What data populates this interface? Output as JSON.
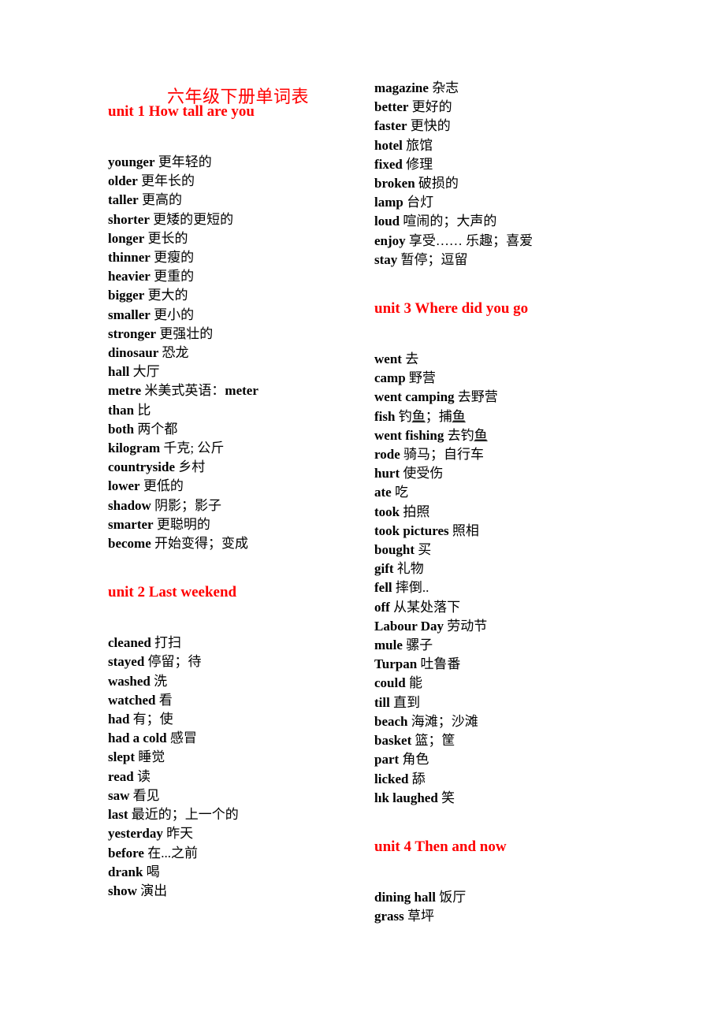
{
  "document": {
    "title": "六年级下册单词表",
    "title_color": "#ff0000",
    "heading_color": "#ff0000",
    "body_color": "#000000",
    "background": "#ffffff"
  },
  "columns": {
    "left": {
      "blocks": [
        {
          "type": "heading",
          "text": "unit 1 How tall are you"
        },
        {
          "type": "list",
          "entries": [
            {
              "en": "younger",
              "cn": "更年轻的"
            },
            {
              "en": "older",
              "cn": "更年长的"
            },
            {
              "en": "taller",
              "cn": "更高的"
            },
            {
              "en": "shorter",
              "cn": "更矮的更短的"
            },
            {
              "en": "longer",
              "cn": "更长的"
            },
            {
              "en": "thinner",
              "cn": "更瘦的"
            },
            {
              "en": "heavier",
              "cn": "更重的"
            },
            {
              "en": "bigger",
              "cn": "更大的"
            },
            {
              "en": "smaller",
              "cn": "更小的"
            },
            {
              "en": "stronger",
              "cn": "更强壮的"
            },
            {
              "en": "dinosaur",
              "cn": "恐龙"
            },
            {
              "en": "hall",
              "cn": "大厅"
            },
            {
              "en": "metre",
              "cn": "米美式英语：",
              "cn_bold_tail": "meter"
            },
            {
              "en": "than",
              "cn": "比"
            },
            {
              "en": "both",
              "cn": "两个都"
            },
            {
              "en": "kilogram",
              "cn": "千克; 公斤"
            },
            {
              "en": "countryside",
              "cn": "乡村"
            },
            {
              "en": "lower",
              "cn": " 更低的"
            },
            {
              "en": "shadow",
              "cn": "阴影；影子"
            },
            {
              "en": "smarter",
              "cn": "更聪明的"
            },
            {
              "en": "become",
              "cn": "开始变得；变成"
            }
          ]
        },
        {
          "type": "heading",
          "text": "unit 2 Last weekend"
        },
        {
          "type": "list",
          "entries": [
            {
              "en": "cleaned",
              "cn": "打扫"
            },
            {
              "en": "stayed",
              "cn": "停留；待"
            },
            {
              "en": "washed",
              "cn": "洗"
            },
            {
              "en": "watched",
              "cn": "看"
            },
            {
              "en": "had",
              "cn": "有；使"
            },
            {
              "en": "had a cold",
              "cn": "感冒"
            },
            {
              "en": "slept",
              "cn": "睡觉"
            },
            {
              "en": "read",
              "cn": "读"
            },
            {
              "en": "saw",
              "cn": "看见"
            },
            {
              "en": "last",
              "cn": "最近的；上一个的"
            },
            {
              "en": "yesterday",
              "cn": "昨天"
            },
            {
              "en": "before",
              "cn": "在...之前"
            },
            {
              "en": "drank",
              "cn": "喝"
            },
            {
              "en": "show",
              "cn": "演出"
            }
          ]
        }
      ]
    },
    "right": {
      "blocks": [
        {
          "type": "list",
          "entries": [
            {
              "en": "magazine",
              "cn": "杂志"
            },
            {
              "en": "better",
              "cn": "更好的"
            },
            {
              "en": "faster",
              "cn": "更快的"
            },
            {
              "en": "hotel",
              "cn": "旅馆"
            },
            {
              "en": "fixed",
              "cn": "修理"
            },
            {
              "en": "broken",
              "cn": "破损的"
            },
            {
              "en": "lamp",
              "cn": "台灯"
            },
            {
              "en": "loud",
              "cn": "喧闹的；大声的"
            },
            {
              "en": "enjoy",
              "cn": "享受…… 乐趣；喜爱"
            },
            {
              "en": "stay",
              "cn": "暂停；逗留"
            }
          ]
        },
        {
          "type": "heading",
          "text": "unit 3 Where did you go"
        },
        {
          "type": "list",
          "entries": [
            {
              "en": "went",
              "cn": "去"
            },
            {
              "en": "camp",
              "cn": "野营"
            },
            {
              "en": "went camping",
              "cn": "去野营"
            },
            {
              "en": "fish",
              "cn": "钓鱼；捕鱼",
              "underline": true
            },
            {
              "en": "went fishing",
              "cn": "去钓鱼",
              "underline": true
            },
            {
              "en": "rode",
              "cn": "骑马；自行车"
            },
            {
              "en": "hurt",
              "cn": "使受伤"
            },
            {
              "en": "ate",
              "cn": "吃"
            },
            {
              "en": "took",
              "cn": "拍照"
            },
            {
              "en": "took pictures",
              "cn": "照相"
            },
            {
              "en": "bought",
              "cn": "买"
            },
            {
              "en": "gift",
              "cn": "礼物"
            },
            {
              "en": "fell",
              "cn": "摔倒.."
            },
            {
              "en": "off",
              "cn": "从某处落下"
            },
            {
              "en": "Labour Day",
              "cn": "劳动节"
            },
            {
              "en": "mule",
              "cn": "骡子"
            },
            {
              "en": "Turpan",
              "cn": "吐鲁番"
            },
            {
              "en": "could",
              "cn": "能"
            },
            {
              "en": "till",
              "cn": "直到"
            },
            {
              "en": "beach",
              "cn": "海滩；沙滩"
            },
            {
              "en": "basket",
              "cn": "篮；筐"
            },
            {
              "en": "part",
              "cn": "角色"
            },
            {
              "en": "licked",
              "cn": "舔"
            },
            {
              "en": "lık laughed",
              "cn": "笑"
            }
          ]
        },
        {
          "type": "heading",
          "text": "unit 4 Then and now"
        },
        {
          "type": "list",
          "entries": [
            {
              "en": "dining hall",
              "cn": "饭厅"
            },
            {
              "en": "grass",
              "cn": "草坪"
            }
          ]
        }
      ]
    }
  }
}
